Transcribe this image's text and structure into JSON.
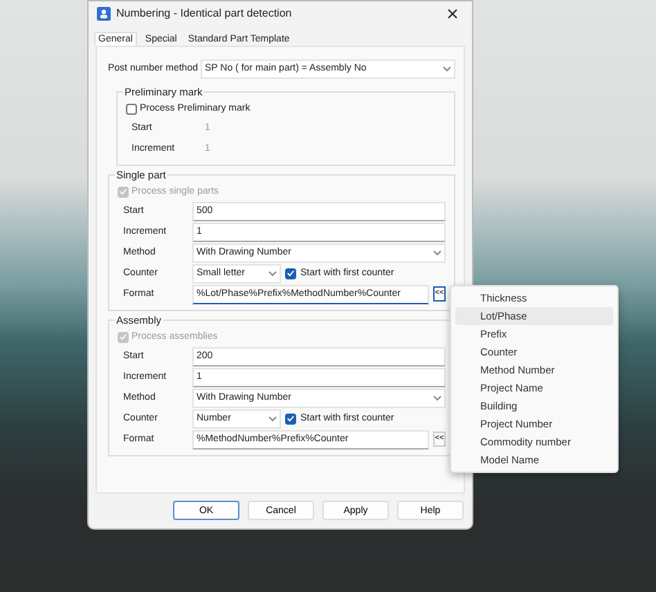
{
  "window": {
    "title": "Numbering - Identical part detection"
  },
  "tabs": [
    {
      "label": "General",
      "selected": true
    },
    {
      "label": "Special",
      "selected": false
    },
    {
      "label": "Standard Part Template",
      "selected": false
    }
  ],
  "post_number_method": {
    "label": "Post number method",
    "value": "SP No ( for main part) = Assembly No"
  },
  "groups": [
    {
      "title": "Preliminary mark",
      "process": {
        "label": "Process Preliminary mark",
        "checked": false,
        "disabled": false
      },
      "fields": [
        {
          "kind": "text",
          "label": "Start",
          "value": "1",
          "disabled": true
        },
        {
          "kind": "text",
          "label": "Increment",
          "value": "1",
          "disabled": true
        }
      ]
    },
    {
      "title": "Single part",
      "process": {
        "label": "Process single parts",
        "checked": true,
        "disabled": true
      },
      "fields": [
        {
          "kind": "text",
          "label": "Start",
          "value": "500",
          "disabled": false
        },
        {
          "kind": "text",
          "label": "Increment",
          "value": "1",
          "disabled": false
        },
        {
          "kind": "select",
          "label": "Method",
          "value": "With Drawing Number"
        },
        {
          "kind": "counter",
          "label": "Counter",
          "value": "Small letter",
          "option": {
            "label": "Start with first counter",
            "checked": true
          }
        },
        {
          "kind": "format",
          "label": "Format",
          "value": "%Lot/Phase%Prefix%MethodNumber%Counter",
          "focused": true,
          "button": "<<"
        }
      ]
    },
    {
      "title": "Assembly",
      "process": {
        "label": "Process assemblies",
        "checked": true,
        "disabled": true
      },
      "fields": [
        {
          "kind": "text",
          "label": "Start",
          "value": "200",
          "disabled": false
        },
        {
          "kind": "text",
          "label": "Increment",
          "value": "1",
          "disabled": false
        },
        {
          "kind": "select",
          "label": "Method",
          "value": "With Drawing Number"
        },
        {
          "kind": "counter",
          "label": "Counter",
          "value": "Number",
          "option": {
            "label": "Start with first counter",
            "checked": true
          }
        },
        {
          "kind": "format",
          "label": "Format",
          "value": "%MethodNumber%Prefix%Counter",
          "focused": false,
          "button": "<<"
        }
      ]
    }
  ],
  "buttons": [
    {
      "label": "OK",
      "default": true
    },
    {
      "label": "Cancel",
      "default": false
    },
    {
      "label": "Apply",
      "default": false
    },
    {
      "label": "Help",
      "default": false
    }
  ],
  "menu": {
    "items": [
      {
        "label": "Thickness",
        "selected": false
      },
      {
        "label": "Lot/Phase",
        "selected": true
      },
      {
        "label": "Prefix",
        "selected": false
      },
      {
        "label": "Counter",
        "selected": false
      },
      {
        "label": "Method Number",
        "selected": false
      },
      {
        "label": "Project Name",
        "selected": false
      },
      {
        "label": "Building",
        "selected": false
      },
      {
        "label": "Project Number",
        "selected": false
      },
      {
        "label": "Commodity number",
        "selected": false
      },
      {
        "label": "Model Name",
        "selected": false
      }
    ]
  }
}
